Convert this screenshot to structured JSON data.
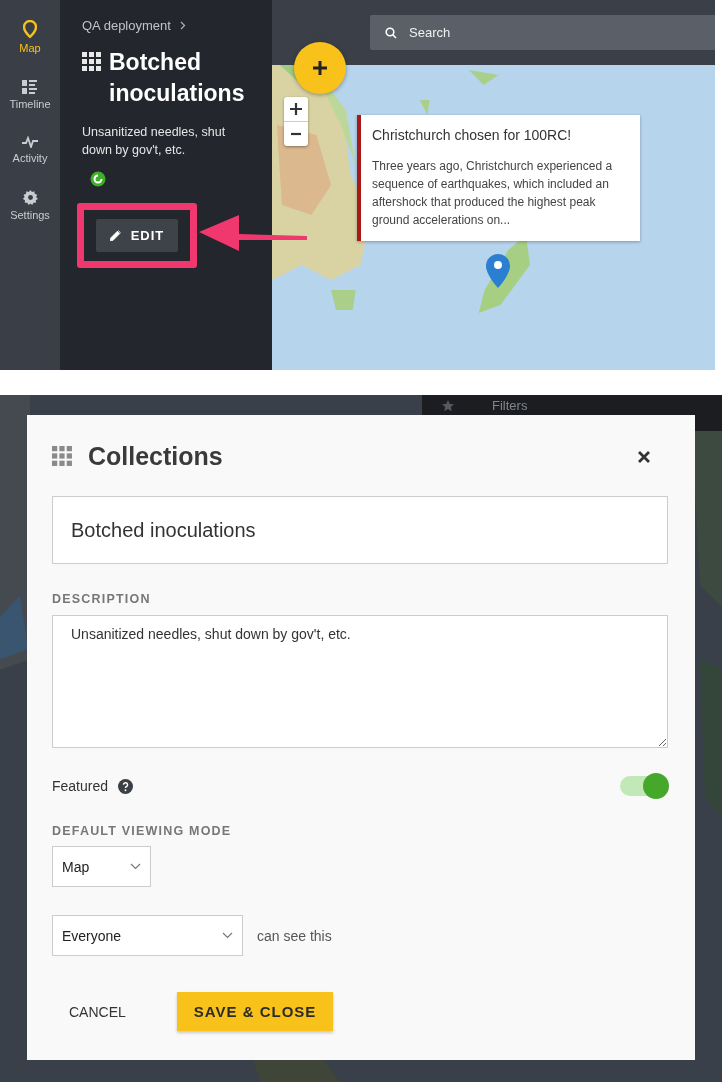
{
  "nav": [
    {
      "kind": "map",
      "label": "Map",
      "selected": true
    },
    {
      "kind": "timeline",
      "label": "Timeline",
      "selected": false
    },
    {
      "kind": "activity",
      "label": "Activity",
      "selected": false
    },
    {
      "kind": "settings",
      "label": "Settings",
      "selected": false
    }
  ],
  "panel": {
    "breadcrumb": "QA deployment",
    "title": "Botched inoculations",
    "description": "Unsanitized needles, shut down by gov't, etc.",
    "edit_button": "EDIT"
  },
  "search": {
    "placeholder": "Search"
  },
  "popup": {
    "title": "Christchurch chosen for 100RC!",
    "body": "Three years ago, Christchurch experienced a sequence of earthquakes, which included an aftershock that produced the highest peak ground accelerations on..."
  },
  "filters_bar": {
    "label": "Filters"
  },
  "modal": {
    "title": "Collections",
    "name_value": "Botched inoculations",
    "description_label": "DESCRIPTION",
    "description_value": "Unsanitized needles, shut down by gov't, etc.",
    "featured": {
      "label": "Featured",
      "on": true
    },
    "viewing_mode": {
      "label": "DEFAULT VIEWING MODE",
      "value": "Map"
    },
    "visibility": {
      "value": "Everyone",
      "suffix": "can see this"
    },
    "cancel_button": "CANCEL",
    "save_button": "SAVE & CLOSE"
  }
}
